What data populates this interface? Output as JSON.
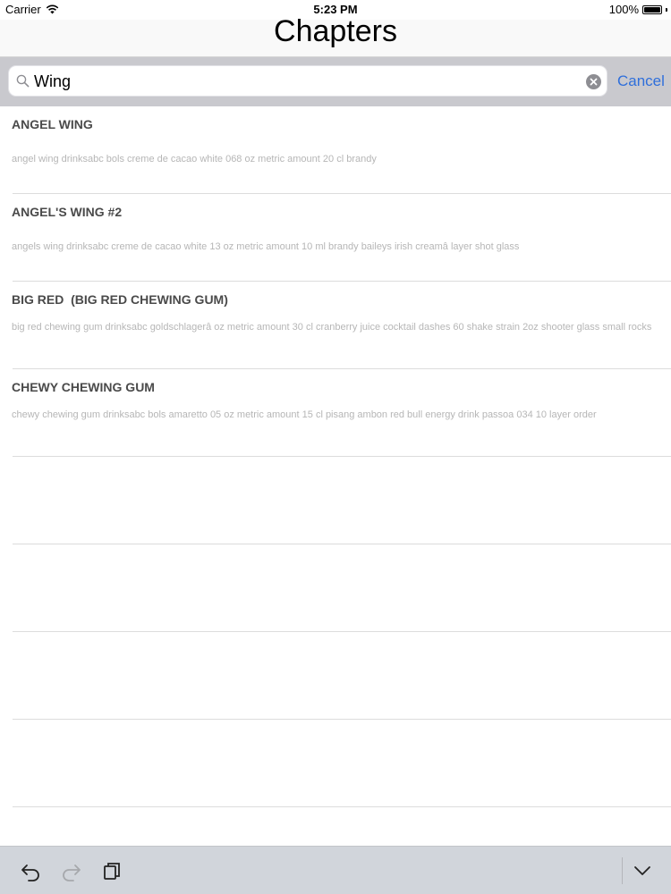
{
  "status_bar": {
    "carrier": "Carrier",
    "time": "5:23 PM",
    "battery": "100%",
    "battery_level": 1.0
  },
  "header": {
    "title": "Chapters"
  },
  "search": {
    "value": "Wing",
    "cancel_label": "Cancel"
  },
  "results": [
    {
      "title": "ANGEL WING",
      "description": "angel wing drinksabc bols creme de cacao white 068 oz metric amount 20 cl brandy"
    },
    {
      "title": "ANGEL'S WING #2",
      "description": "angels wing drinksabc creme de cacao white 13 oz metric amount 10 ml brandy baileys irish creamâ layer shot glass"
    },
    {
      "title": "BIG RED  (BIG RED CHEWING GUM)",
      "description": "big red chewing gum drinksabc goldschlagerâ oz metric amount 30 cl cranberry juice cocktail dashes 60 shake strain 2oz shooter glass small rocks"
    },
    {
      "title": "CHEWY CHEWING GUM",
      "description": "chewy chewing gum drinksabc bols amaretto 05 oz metric amount 15 cl pisang ambon red bull energy drink passoa 034 10 layer order"
    }
  ],
  "empty_rows": 4,
  "toolbar": {
    "icons": [
      "undo-icon",
      "redo-icon",
      "paste-icon",
      "keyboard-dismiss-icon"
    ]
  },
  "colors": {
    "accent": "#2f6fdb",
    "search_bar_bg": "#c9c9ce",
    "toolbar_bg": "#d1d5db",
    "title_text": "#4a4a4a",
    "desc_text": "#b6b6b6"
  }
}
